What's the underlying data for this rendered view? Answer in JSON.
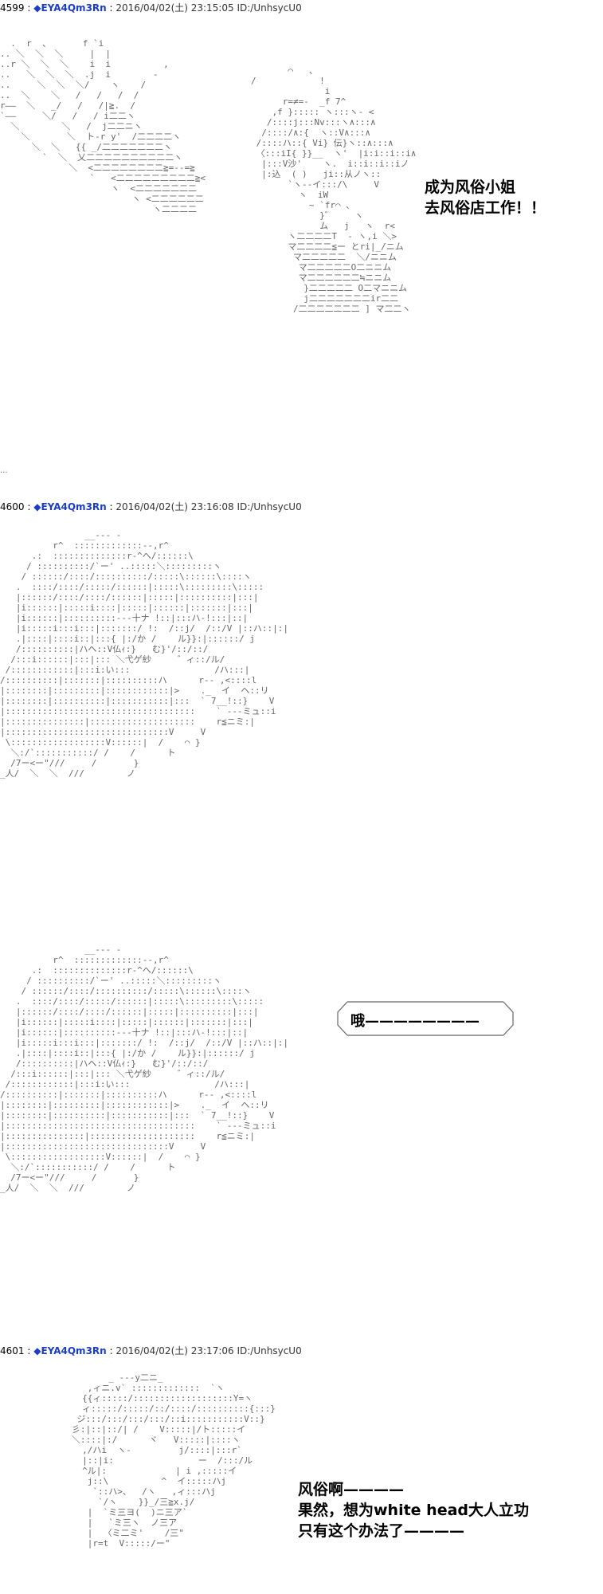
{
  "posts": [
    {
      "number": "4599",
      "diamond": "◆",
      "trip": "EYA4Qm3Rn",
      "date": "2016/04/02(土) 23:15:05",
      "id": "ID:/UnhsycU0",
      "speech": [
        "成为风俗小姐",
        "去风俗店工作！！"
      ]
    },
    {
      "number": "4600",
      "diamond": "◆",
      "trip": "EYA4Qm3Rn",
      "date": "2016/04/02(土) 23:16:08",
      "id": "ID:/UnhsycU0",
      "bubble": "哦————————"
    },
    {
      "number": "4601",
      "diamond": "◆",
      "trip": "EYA4Qm3Rn",
      "date": "2016/04/02(土) 23:17:06",
      "id": "ID:/UnhsycU0",
      "speech": [
        "风俗啊————",
        "果然，想为white head大人立功",
        "只有这个办法了————"
      ]
    }
  ],
  "separator": ":",
  "dot_mark": "..."
}
